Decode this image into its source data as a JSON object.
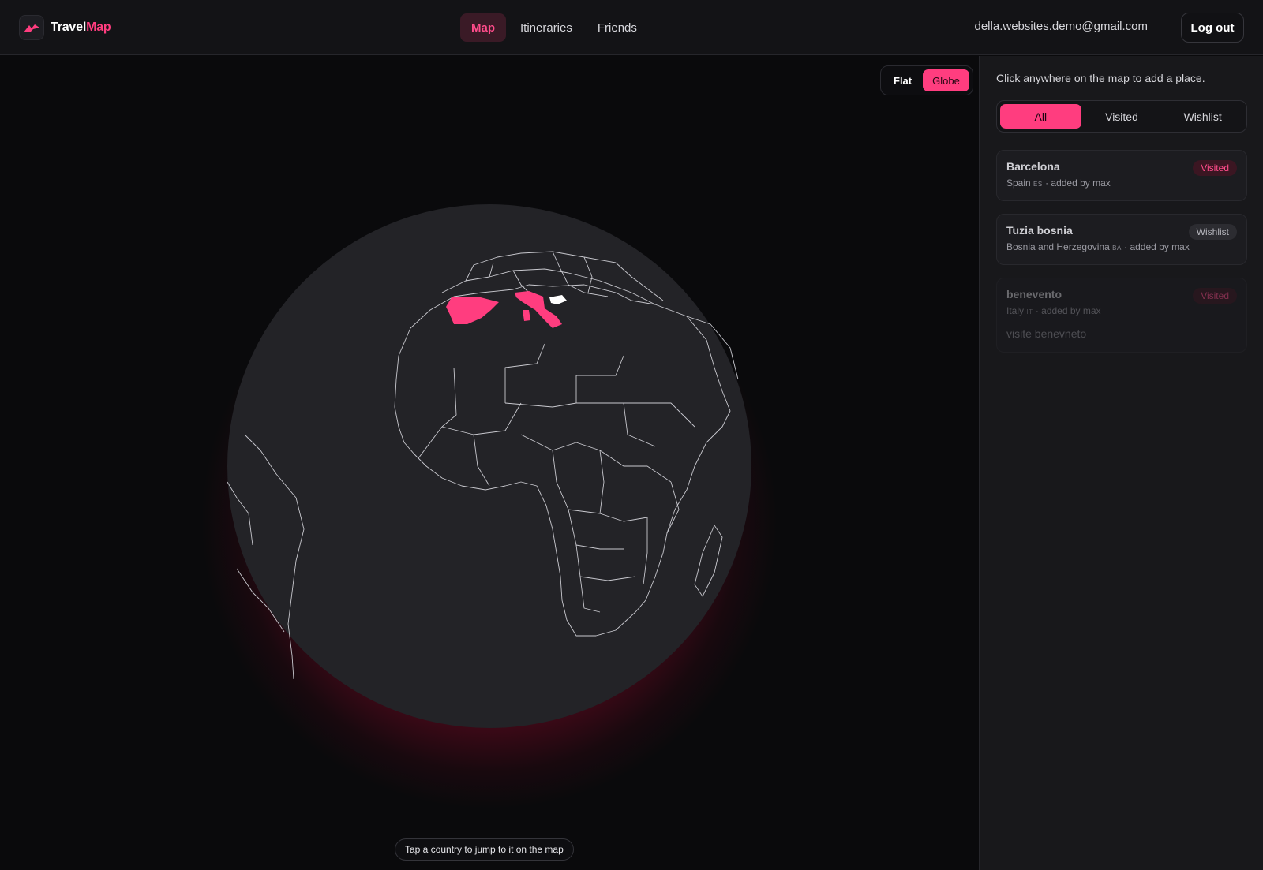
{
  "header": {
    "logo_part1": "Travel",
    "logo_part2": "Map",
    "nav": [
      {
        "label": "Map",
        "active": true
      },
      {
        "label": "Itineraries",
        "active": false
      },
      {
        "label": "Friends",
        "active": false
      }
    ],
    "user_email": "della.websites.demo@gmail.com",
    "logout_label": "Log out"
  },
  "map": {
    "view_toggle": {
      "flat_label": "Flat",
      "globe_label": "Globe",
      "selected": "Globe"
    },
    "hint": "Tap a country to jump to it on the map",
    "highlighted_countries": [
      {
        "name": "Spain",
        "status": "visited"
      },
      {
        "name": "Italy",
        "status": "visited"
      },
      {
        "name": "Bosnia and Herzegovina",
        "status": "wishlist"
      }
    ],
    "colors": {
      "accent": "#ff3d7f",
      "globe": "#232327",
      "border_lines": "#c9c9cf",
      "glow": "#8a0a2c",
      "wishlist_fill": "#ffffff"
    }
  },
  "sidebar": {
    "hint": "Click anywhere on the map to add a place.",
    "filters": [
      {
        "label": "All",
        "active": true
      },
      {
        "label": "Visited",
        "active": false
      },
      {
        "label": "Wishlist",
        "active": false
      }
    ],
    "places": [
      {
        "title": "Barcelona",
        "country": "Spain",
        "code": "ES",
        "added_by": "· added by max",
        "status": "Visited",
        "note": ""
      },
      {
        "title": "Tuzia bosnia",
        "country": "Bosnia and Herzegovina",
        "code": "BA",
        "added_by": "· added by max",
        "status": "Wishlist",
        "note": ""
      },
      {
        "title": "benevento",
        "country": "Italy",
        "code": "IT",
        "added_by": "· added by max",
        "status": "Visited",
        "note": "visite benevneto"
      }
    ]
  }
}
